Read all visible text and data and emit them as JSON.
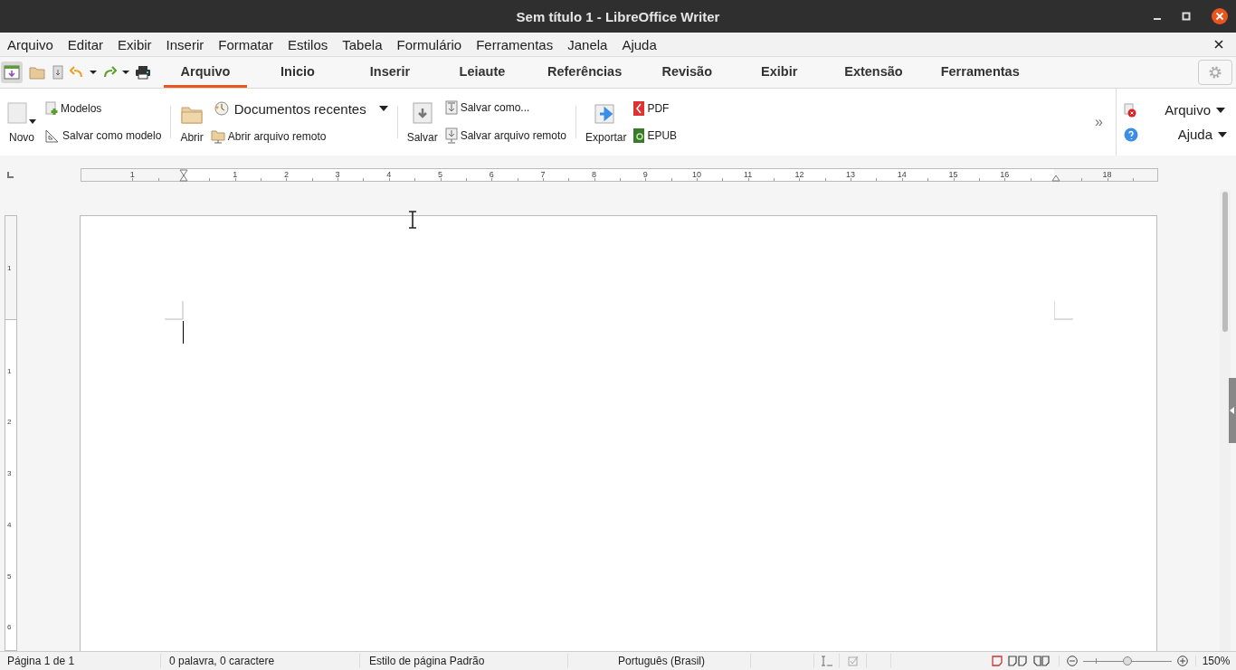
{
  "window": {
    "title": "Sem título 1 - LibreOffice Writer"
  },
  "menu": {
    "items": [
      "Arquivo",
      "Editar",
      "Exibir",
      "Inserir",
      "Formatar",
      "Estilos",
      "Tabela",
      "Formulário",
      "Ferramentas",
      "Janela",
      "Ajuda"
    ]
  },
  "tabs": [
    {
      "label": "Arquivo",
      "selected": true
    },
    {
      "label": "Inicio",
      "selected": false
    },
    {
      "label": "Inserir",
      "selected": false
    },
    {
      "label": "Leiaute",
      "selected": false
    },
    {
      "label": "Referências",
      "selected": false
    },
    {
      "label": "Revisão",
      "selected": false
    },
    {
      "label": "Exibir",
      "selected": false
    },
    {
      "label": "Extensão",
      "selected": false
    },
    {
      "label": "Ferramentas",
      "selected": false
    }
  ],
  "ribbon": {
    "groups": [
      {
        "main": {
          "label": "Novo",
          "dropdown": true
        },
        "items": [
          {
            "label": "Modelos",
            "dropdown": false
          },
          {
            "label": "Salvar como modelo",
            "dropdown": false
          }
        ]
      },
      {
        "main": {
          "label": "Abrir",
          "dropdown": false
        },
        "items": [
          {
            "label": "Documentos recentes",
            "dropdown": true
          },
          {
            "label": "Abrir arquivo remoto",
            "dropdown": false
          }
        ]
      },
      {
        "main": {
          "label": "Salvar",
          "dropdown": false
        },
        "items": [
          {
            "label": "Salvar como...",
            "dropdown": false
          },
          {
            "label": "Salvar arquivo remoto",
            "dropdown": false
          }
        ]
      },
      {
        "main": {
          "label": "Exportar",
          "dropdown": false
        },
        "items": [
          {
            "label": "PDF",
            "dropdown": false
          },
          {
            "label": "EPUB",
            "dropdown": false
          }
        ]
      }
    ],
    "more": "»",
    "side": [
      {
        "label": "Arquivo"
      },
      {
        "label": "Ajuda"
      }
    ]
  },
  "ruler": {
    "horizontal": [
      "1",
      "1",
      "2",
      "3",
      "4",
      "5",
      "6",
      "7",
      "8",
      "9",
      "10",
      "11",
      "12",
      "13",
      "14",
      "15",
      "16",
      "18"
    ],
    "vertical": [
      "1",
      "1",
      "2",
      "3",
      "4",
      "5",
      "6"
    ]
  },
  "status_bar": {
    "page": "Página 1 de 1",
    "words": "0 palavra, 0 caractere",
    "page_style": "Estilo de página Padrão",
    "language": "Português (Brasil)",
    "zoom": {
      "level": 0.5,
      "reading": "150%"
    }
  }
}
